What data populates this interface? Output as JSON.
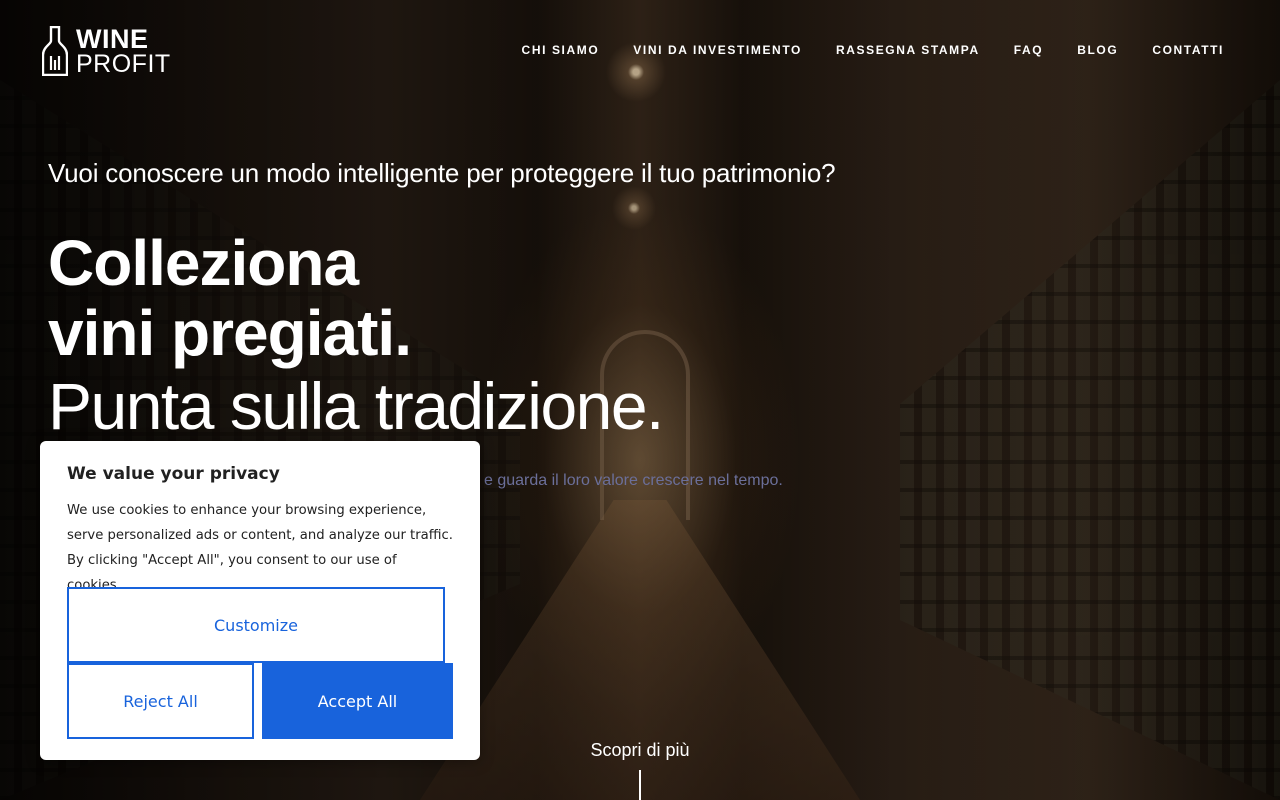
{
  "brand": {
    "line1": "WINE",
    "line2": "PROFIT"
  },
  "nav": {
    "items": [
      {
        "label": "CHI SIAMO"
      },
      {
        "label": "VINI DA INVESTIMENTO"
      },
      {
        "label": "RASSEGNA STAMPA"
      },
      {
        "label": "FAQ"
      },
      {
        "label": "BLOG"
      },
      {
        "label": "CONTATTI"
      }
    ]
  },
  "hero": {
    "question": "Vuoi conoscere un modo intelligente per proteggere il tuo patrimonio?",
    "title_line1": "Colleziona",
    "title_line2": "vini pregiati.",
    "title_line3": "Punta sulla tradizione.",
    "subtitle_visible": "e guarda il loro valore crescere nel tempo.",
    "scroll_label": "Scopri di più"
  },
  "cookie_banner": {
    "title": "We value your privacy",
    "text": "We use cookies to enhance your browsing experience, serve personalized ads or content, and analyze our traffic. By clicking \"Accept All\", you consent to our use of cookies.",
    "customize_label": "Customize",
    "reject_label": "Reject All",
    "accept_label": "Accept All"
  },
  "colors": {
    "accent": "#1863dc",
    "hero_sub_text": "#6b6f9a"
  }
}
